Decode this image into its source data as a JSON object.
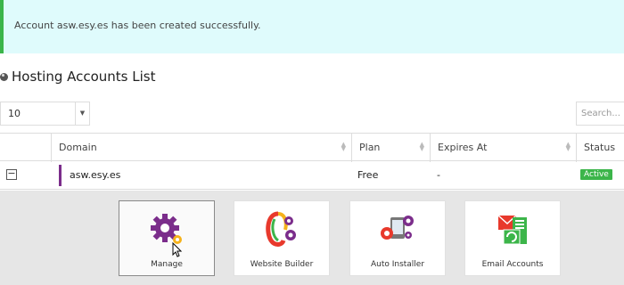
{
  "alert": {
    "message": "Account asw.esy.es has been created successfully."
  },
  "section": {
    "title": "Hosting Accounts List",
    "icon": "globe-icon"
  },
  "controls": {
    "page_size": "10",
    "search_placeholder": "Search..."
  },
  "table": {
    "columns": [
      "",
      "Domain",
      "Plan",
      "Expires At",
      "Status"
    ],
    "rows": [
      {
        "domain": "asw.esy.es",
        "plan": "Free",
        "expires": "-",
        "status": "Active"
      }
    ]
  },
  "actions": [
    {
      "label": "Manage",
      "icon": "gear-icon",
      "selected": true
    },
    {
      "label": "Website Builder",
      "icon": "website-builder-icon",
      "selected": false
    },
    {
      "label": "Auto Installer",
      "icon": "auto-installer-icon",
      "selected": false
    },
    {
      "label": "Email Accounts",
      "icon": "email-accounts-icon",
      "selected": false
    }
  ],
  "colors": {
    "alert_bg": "#dffbfc",
    "alert_border": "#3bb54a",
    "accent_purple": "#7b2d8b",
    "status_active": "#3cb54a",
    "panel_bg": "#e6e6e6"
  }
}
